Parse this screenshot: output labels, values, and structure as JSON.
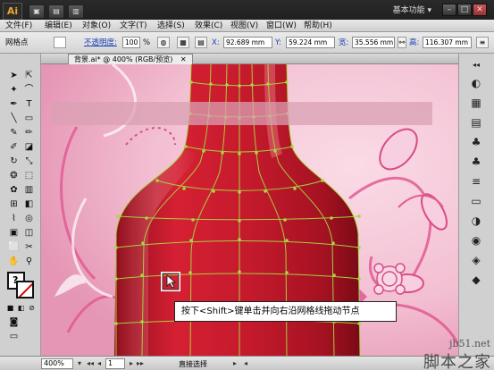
{
  "app": {
    "logo_text": "Ai",
    "workspace_label": "基本功能",
    "workspace_arrow": "▾",
    "window_controls": [
      "–",
      "□",
      "✕"
    ],
    "title_buttons": [
      "▣",
      "▤",
      "▥"
    ]
  },
  "menu": {
    "items": [
      "文件(F)",
      "编辑(E)",
      "对象(O)",
      "文字(T)",
      "选择(S)",
      "效果(C)",
      "视图(V)",
      "窗口(W)",
      "帮助(H)"
    ]
  },
  "control_panel": {
    "tool_name": "网格点",
    "opacity_label": "不透明度:",
    "opacity_value": "100",
    "opacity_unit": "%",
    "x_label": "X:",
    "x_value": "92.689 mm",
    "y_label": "Y:",
    "y_value": "59.224 mm",
    "w_label": "宽:",
    "w_value": "35.556 mm",
    "h_label": "高:",
    "h_value": "116.307 mm"
  },
  "document": {
    "tab_label": "背景.ai* @ 400% (RGB/预览)",
    "close_icon": "✕"
  },
  "tooltip": {
    "text": "按下<Shift>键单击并向右沿网格线拖动节点"
  },
  "status": {
    "zoom": "400%",
    "page": "1",
    "tool_text": "直接选择"
  },
  "watermark": {
    "url": "jb51.net",
    "name": "脚本之家"
  },
  "colors": {
    "bottle_red": "#c7182a",
    "mesh_green": "#a8d840",
    "canvas_pink": "#f0b7cc",
    "accent_pink": "#e25a93"
  }
}
